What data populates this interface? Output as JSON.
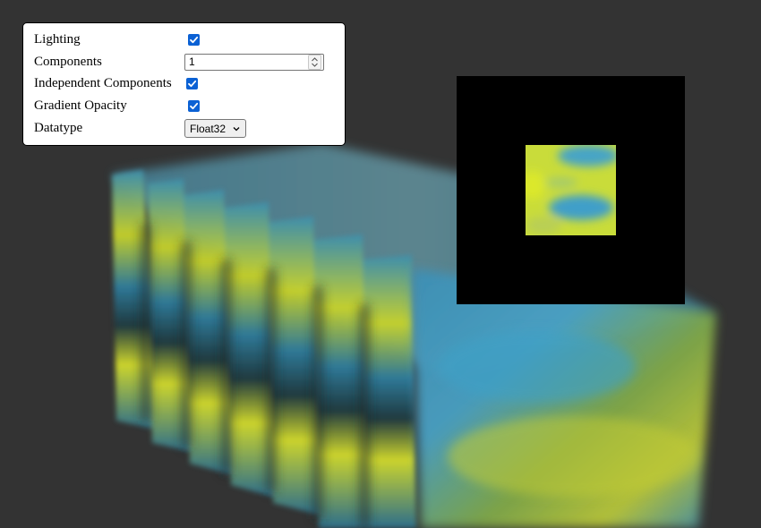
{
  "controls": {
    "lighting": {
      "label": "Lighting",
      "checked": true
    },
    "components": {
      "label": "Components",
      "value": "1"
    },
    "independent_components": {
      "label": "Independent Components",
      "checked": true
    },
    "gradient_opacity": {
      "label": "Gradient Opacity",
      "checked": true
    },
    "datatype": {
      "label": "Datatype",
      "selected": "Float32"
    }
  },
  "colors": {
    "background": "#333333",
    "checkbox_accent": "#0b61d4",
    "volume_yellow": "#d8e02a",
    "volume_blue": "#3d9cc4",
    "preview_background": "#000000"
  }
}
